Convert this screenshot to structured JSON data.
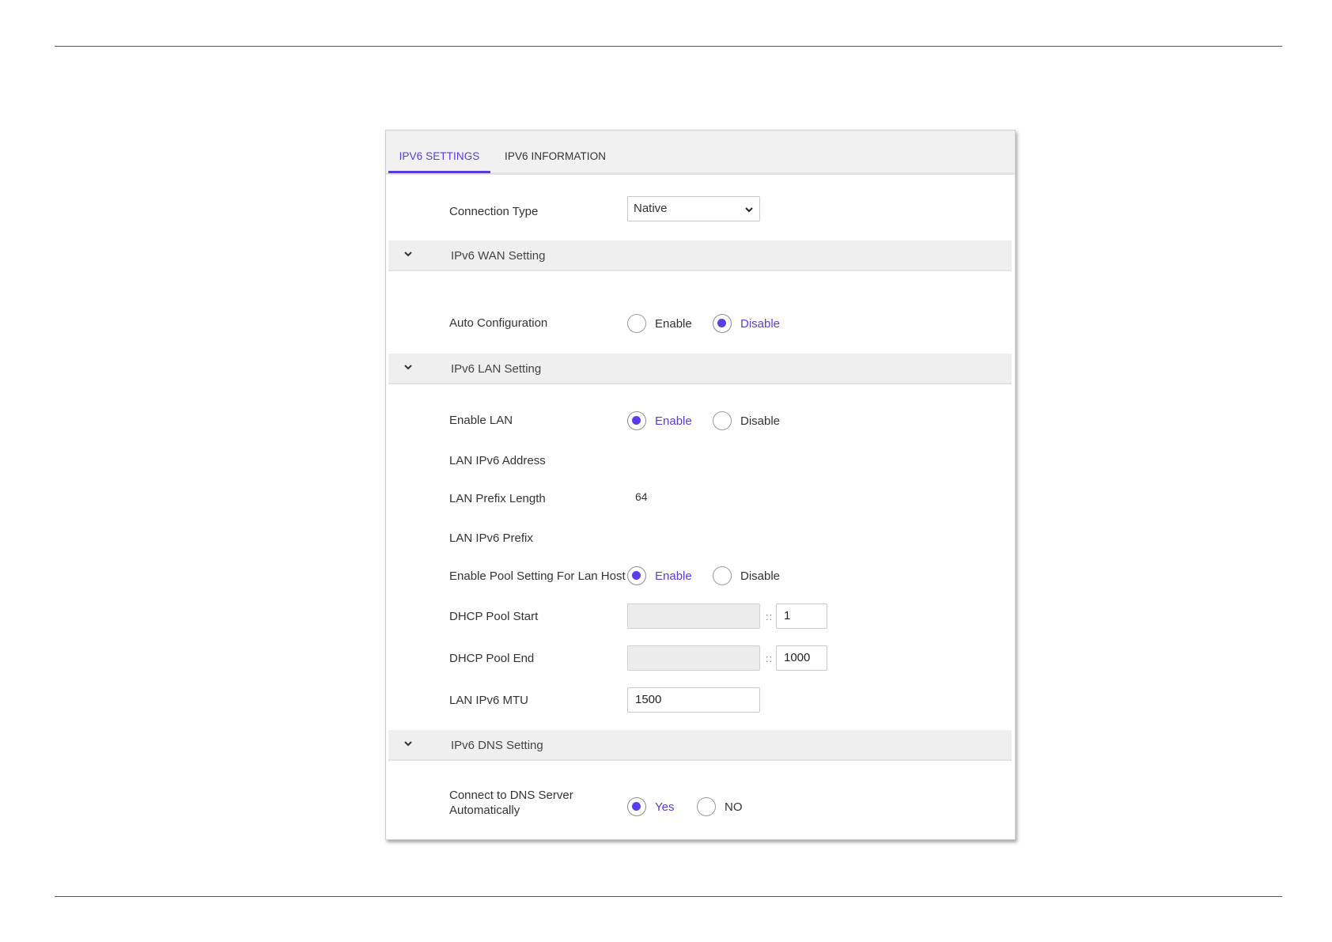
{
  "tabs": [
    {
      "label": "IPV6 SETTINGS",
      "active": true
    },
    {
      "label": "IPV6 INFORMATION",
      "active": false
    }
  ],
  "connection_type": {
    "label": "Connection Type",
    "value": "Native"
  },
  "sections": {
    "wan": "IPv6 WAN Setting",
    "lan": "IPv6 LAN Setting",
    "dns": "IPv6 DNS Setting"
  },
  "auto_configuration": {
    "label": "Auto Configuration",
    "option_enable": "Enable",
    "option_disable": "Disable",
    "selected": "Disable"
  },
  "enable_lan": {
    "label": "Enable LAN",
    "option_enable": "Enable",
    "option_disable": "Disable",
    "selected": "Enable"
  },
  "lan_ipv6_address": {
    "label": "LAN IPv6 Address"
  },
  "lan_prefix_length": {
    "label": "LAN Prefix Length",
    "value": "64"
  },
  "lan_ipv6_prefix": {
    "label": "LAN IPv6 Prefix"
  },
  "pool_setting": {
    "label": "Enable Pool Setting For Lan Host",
    "option_enable": "Enable",
    "option_disable": "Disable",
    "selected": "Enable"
  },
  "dhcp_pool_start": {
    "label": "DHCP Pool Start",
    "prefix": "",
    "separator": "::",
    "suffix": "1"
  },
  "dhcp_pool_end": {
    "label": "DHCP Pool End",
    "prefix": "",
    "separator": "::",
    "suffix": "1000"
  },
  "lan_ipv6_mtu": {
    "label": "LAN IPv6 MTU",
    "value": "1500"
  },
  "dns_auto": {
    "label_line1": "Connect to DNS Server",
    "label_line2": "Automatically",
    "option_yes": "Yes",
    "option_no": "NO",
    "selected": "Yes"
  },
  "colors": {
    "accent": "#5a3bd6",
    "section_bg": "#efefef",
    "tabbar_bg": "#f1f1f1"
  }
}
